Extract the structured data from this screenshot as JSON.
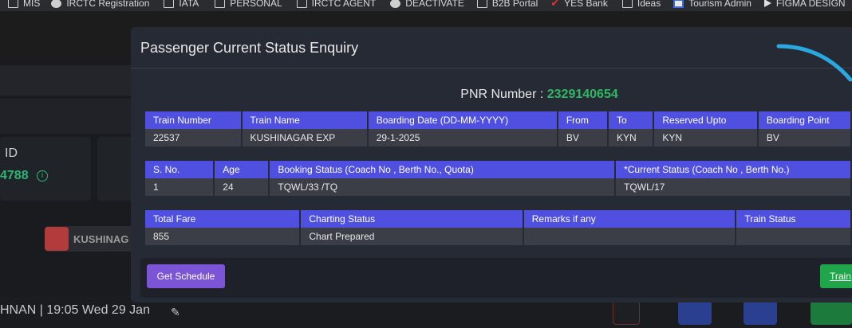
{
  "bookmarks": [
    {
      "label": "MIS",
      "icon": "folder-icon"
    },
    {
      "label": "IRCTC Registration",
      "icon": "globe-icon"
    },
    {
      "label": "IATA",
      "icon": "folder-icon"
    },
    {
      "label": "PERSONAL",
      "icon": "folder-icon"
    },
    {
      "label": "IRCTC AGENT",
      "icon": "folder-icon"
    },
    {
      "label": "DEACTIVATE",
      "icon": "globe-icon"
    },
    {
      "label": "B2B Portal",
      "icon": "folder-icon"
    },
    {
      "label": "YES Bank",
      "icon": "check-icon"
    },
    {
      "label": "Ideas",
      "icon": "folder-icon"
    },
    {
      "label": "Tourism Admin",
      "icon": "tourism-icon"
    },
    {
      "label": "FIGMA DESIGN",
      "icon": "play-icon"
    }
  ],
  "background": {
    "id_label": "ID",
    "id_value": "4788",
    "train_label": "KUSHINAG",
    "footer_text": "HNAN | 19:05 Wed 29 Jan"
  },
  "modal": {
    "title": "Passenger Current Status Enquiry",
    "pnr_label": "PNR Number :",
    "pnr_value": "2329140654",
    "train_table": {
      "headers": [
        "Train Number",
        "Train Name",
        "Boarding Date (DD-MM-YYYY)",
        "From",
        "To",
        "Reserved Upto",
        "Boarding Point"
      ],
      "row": [
        "22537",
        "KUSHINAGAR EXP",
        "29-1-2025",
        "BV",
        "KYN",
        "KYN",
        "BV"
      ]
    },
    "passenger_table": {
      "headers": [
        "S. No.",
        "Age",
        "Booking Status (Coach No , Berth No., Quota)",
        "*Current Status (Coach No , Berth No.)"
      ],
      "row": [
        "1",
        "24",
        "TQWL/33 /TQ",
        "TQWL/17"
      ]
    },
    "fare_table": {
      "headers": [
        "Total Fare",
        "Charting Status",
        "Remarks if any",
        "Train Status"
      ],
      "row": [
        "855",
        "Chart Prepared",
        "",
        ""
      ]
    },
    "get_schedule_label": "Get Schedule",
    "train_button_label": "Train"
  }
}
